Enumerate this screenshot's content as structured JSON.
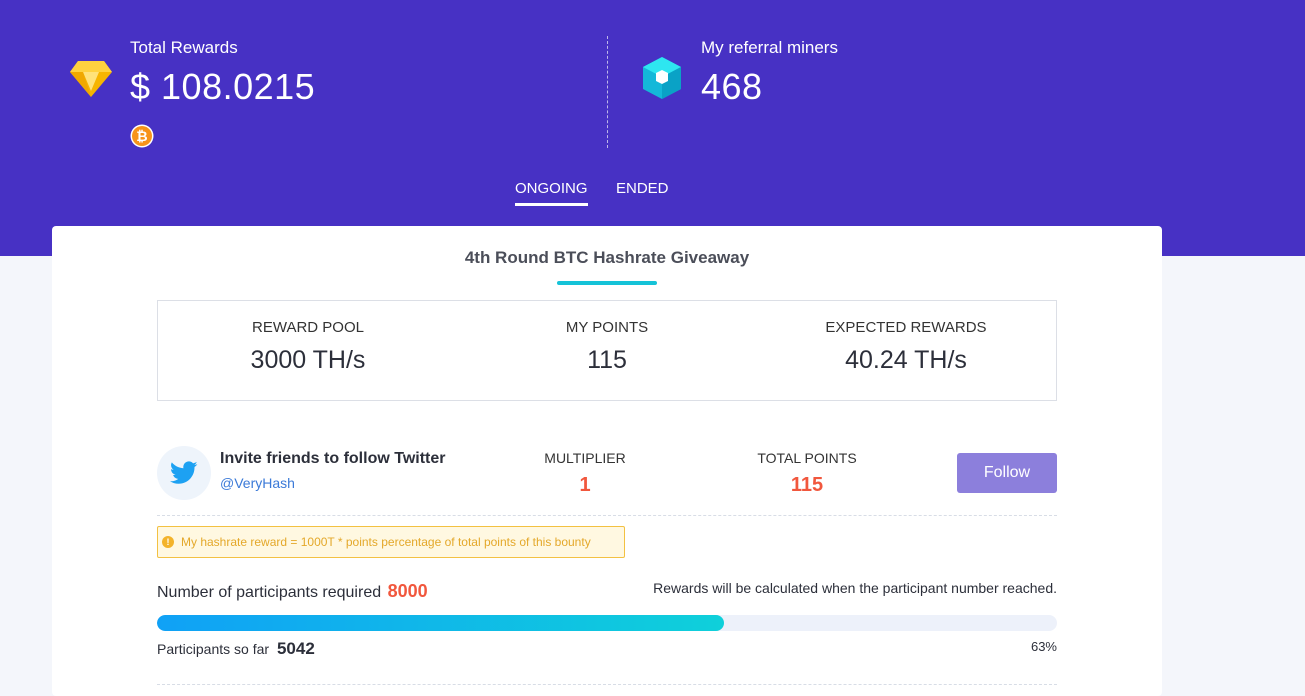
{
  "header": {
    "total_rewards": {
      "label": "Total Rewards",
      "value": "$ 108.0215",
      "coin_icon": "bitcoin-icon"
    },
    "referral": {
      "label": "My referral miners",
      "value": "468"
    }
  },
  "tabs": [
    {
      "label": "ONGOING",
      "active": true
    },
    {
      "label": "ENDED",
      "active": false
    }
  ],
  "campaign": {
    "title": "4th Round BTC Hashrate Giveaway",
    "summary": [
      {
        "label": "REWARD POOL",
        "value": "3000 TH/s"
      },
      {
        "label": "MY POINTS",
        "value": "115"
      },
      {
        "label": "EXPECTED REWARDS",
        "value": "40.24 TH/s"
      }
    ],
    "task": {
      "title": "Invite friends to follow Twitter",
      "handle": "@VeryHash",
      "multiplier_label": "MULTIPLIER",
      "multiplier_value": "1",
      "total_points_label": "TOTAL POINTS",
      "total_points_value": "115",
      "button_label": "Follow"
    },
    "notice": "My hashrate reward = 1000T * points percentage of total points of this bounty",
    "participants": {
      "required_label": "Number of participants required",
      "required_value": "8000",
      "calc_note": "Rewards will be calculated when the participant number reached.",
      "so_far_label": "Participants so far",
      "so_far_value": "5042",
      "percent_label": "63%",
      "progress_fraction": 0.63
    }
  },
  "colors": {
    "hero_bg": "#4731c4",
    "accent_red": "#f1573d",
    "accent_cyan": "#15c3d8",
    "button_bg": "#8c7fdc",
    "notice_border": "#f3c142"
  }
}
